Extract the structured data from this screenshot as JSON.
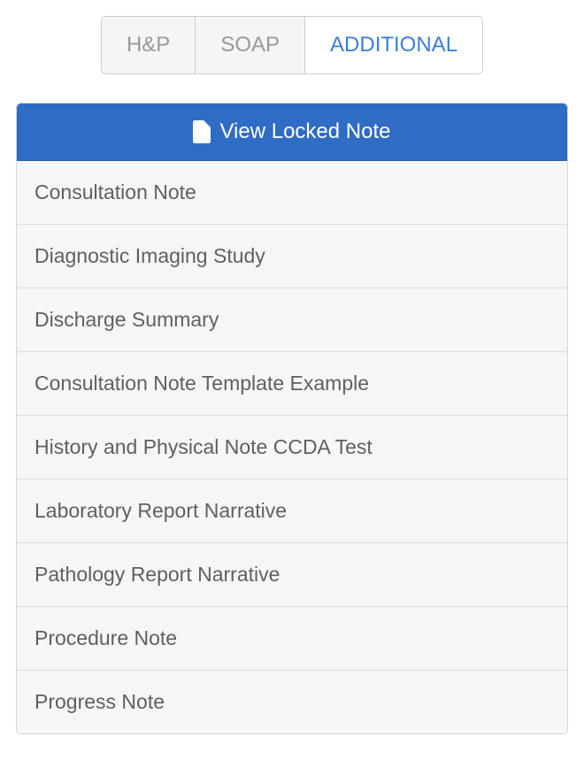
{
  "tabs": [
    {
      "label": "H&P",
      "active": false
    },
    {
      "label": "SOAP",
      "active": false
    },
    {
      "label": "ADDITIONAL",
      "active": true
    }
  ],
  "header": {
    "label": "View Locked Note"
  },
  "notes": [
    "Consultation Note",
    "Diagnostic Imaging Study",
    "Discharge Summary",
    "Consultation Note Template Example",
    "History and Physical Note CCDA Test",
    "Laboratory Report Narrative",
    "Pathology Report Narrative",
    "Procedure Note",
    "Progress Note"
  ]
}
